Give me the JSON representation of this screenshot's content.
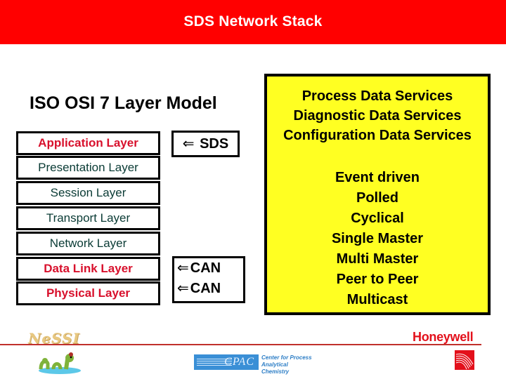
{
  "header": {
    "title": "SDS Network Stack",
    "background_color": "#ff0000"
  },
  "osi_model": {
    "title": "ISO OSI 7 Layer Model",
    "layers": [
      {
        "label": "Application Layer",
        "highlighted": true
      },
      {
        "label": "Presentation Layer",
        "highlighted": false
      },
      {
        "label": "Session Layer",
        "highlighted": false
      },
      {
        "label": "Transport Layer",
        "highlighted": false
      },
      {
        "label": "Network Layer",
        "highlighted": false
      },
      {
        "label": "Data Link Layer",
        "highlighted": true
      },
      {
        "label": "Physical Layer",
        "highlighted": true
      }
    ],
    "highlight_color": "#d8102c"
  },
  "mappings": {
    "arrow_glyph": "⇐",
    "sds": {
      "label": "SDS"
    },
    "can": [
      {
        "label": "CAN"
      },
      {
        "label": "CAN"
      }
    ]
  },
  "services_box": {
    "background_color": "#ffff22",
    "services": [
      "Process Data Services",
      "Diagnostic Data Services",
      "Configuration Data Services"
    ],
    "modes": [
      "Event driven",
      "Polled",
      "Cyclical",
      "Single Master",
      "Multi Master",
      "Peer to Peer",
      "Multicast"
    ]
  },
  "footer": {
    "nessi_logo": "NeSSI",
    "cpac_logo": "CPAC",
    "cpac_caption_line1": "Center for Process",
    "cpac_caption_line2": "Analytical Chemistry",
    "honeywell_logo": "Honeywell",
    "line_color": "#c0302c"
  }
}
